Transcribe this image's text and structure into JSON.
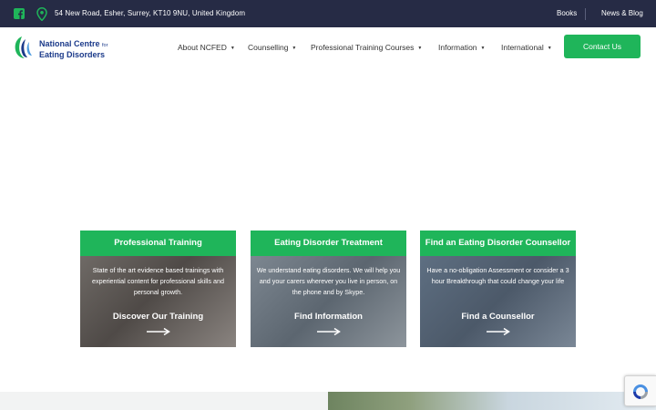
{
  "topbar": {
    "address": "54 New Road, Esher, Surrey, KT10 9NU, United Kingdom",
    "links": [
      "Books",
      "News & Blog"
    ]
  },
  "logo": {
    "line1": "National Centre",
    "line1_small": "for",
    "line2": "Eating Disorders"
  },
  "nav": {
    "items": [
      "About NCFED",
      "Counselling",
      "Professional Training Courses",
      "Information",
      "International"
    ],
    "contact_label": "Contact Us"
  },
  "cards": [
    {
      "title": "Professional Training",
      "description": "State of the art evidence based trainings with experiential content for professional skills and personal growth.",
      "cta": "Discover Our Training"
    },
    {
      "title": "Eating Disorder Treatment",
      "description": "We understand eating disorders. We will help you and your carers wherever you live in person, on the phone and by Skype.",
      "cta": "Find Information"
    },
    {
      "title": "Find an Eating Disorder Counsellor",
      "description": "Have a no-obligation Assessment or consider a 3 hour Breakthrough that could change your life",
      "cta": "Find a Counsellor"
    }
  ],
  "colors": {
    "topbar_bg": "#262b45",
    "accent_green": "#1fb55a",
    "brand_blue": "#1b3a8a"
  },
  "icons": [
    "facebook-icon",
    "location-pin-icon",
    "arrow-right-icon",
    "recaptcha-icon"
  ]
}
